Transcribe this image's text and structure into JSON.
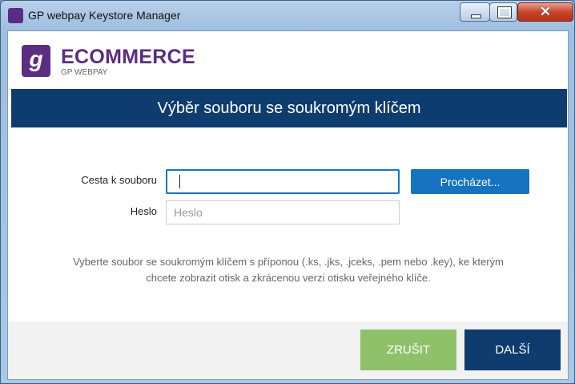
{
  "window": {
    "title": "GP webpay Keystore Manager",
    "close_glyph": "✕"
  },
  "brand": {
    "logo_letter": "g",
    "name": "ECOMMERCE",
    "sub": "GP WEBPAY"
  },
  "banner": {
    "title": "Výběr souboru se soukromým klíčem"
  },
  "form": {
    "path_label": "Cesta k souboru",
    "path_value": "",
    "password_label": "Heslo",
    "password_placeholder": "Heslo",
    "browse_label": "Procházet..."
  },
  "hint": {
    "line1": "Vyberte soubor se soukromým klíčem s příponou (.ks, .jks, .jceks, .pem nebo .key), ke kterým",
    "line2": "chcete zobrazit otisk a zkrácenou verzi otisku veřejného klíče."
  },
  "footer": {
    "cancel_label": "ZRUŠIT",
    "next_label": "DALŠÍ"
  },
  "colors": {
    "brand_purple": "#5c2d82",
    "banner_navy": "#0e3c6e",
    "browse_blue": "#1673c0",
    "cancel_green": "#8fc16b"
  },
  "icons": {
    "app": "gp-webpay-icon",
    "minimize": "minimize-icon",
    "maximize": "maximize-icon",
    "close": "close-icon"
  }
}
